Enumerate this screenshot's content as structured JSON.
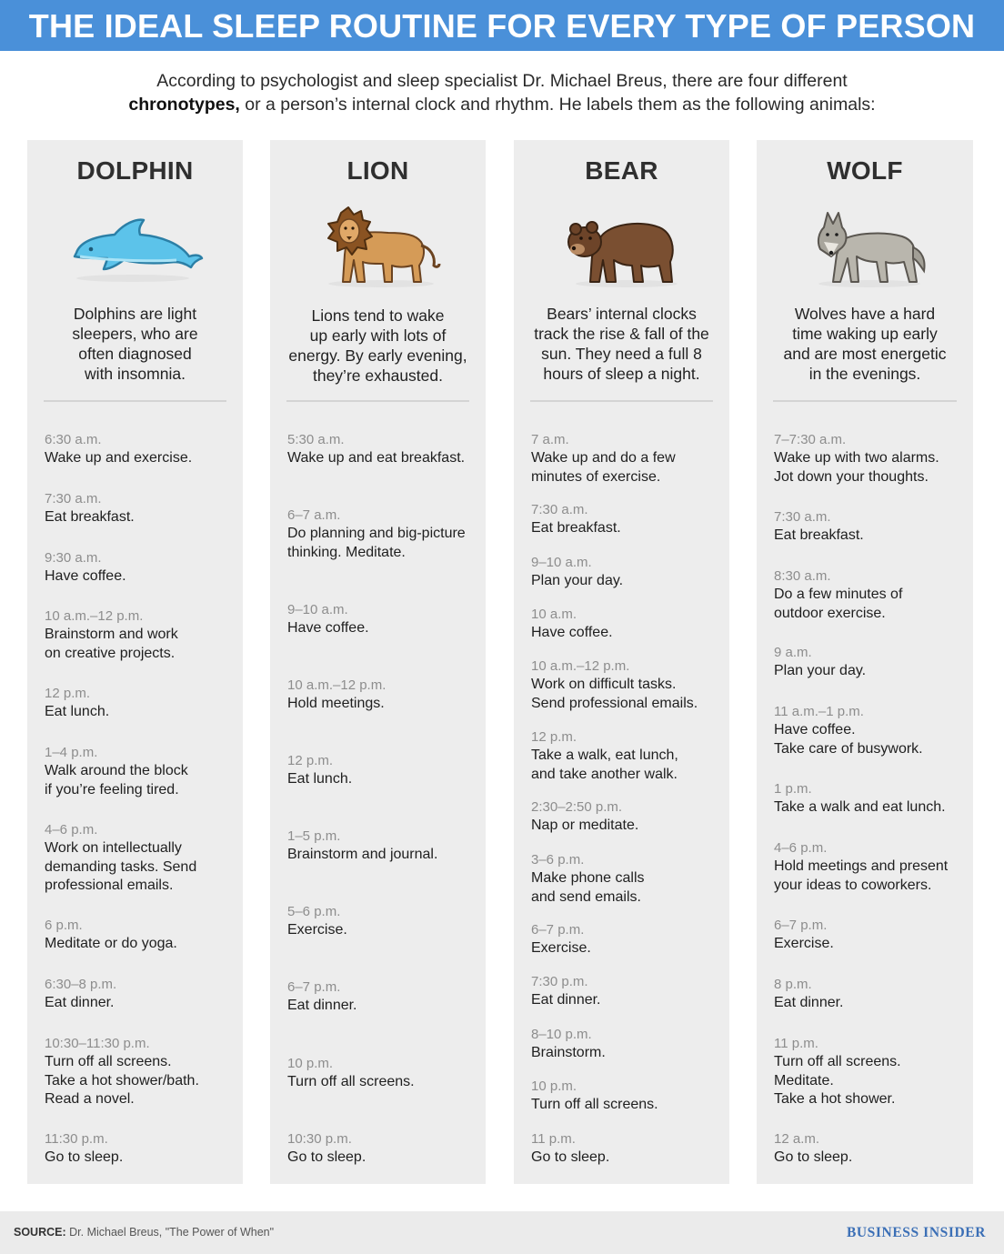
{
  "title": "THE IDEAL SLEEP ROUTINE FOR EVERY TYPE OF PERSON",
  "intro": {
    "line1": "According to psychologist and sleep specialist Dr. Michael Breus, there are four different",
    "line2_bold": "chronotypes,",
    "line2_rest": " or a person’s internal clock and rhythm. He labels them as the following animals:"
  },
  "columns": [
    {
      "name": "DOLPHIN",
      "icon": "dolphin-icon",
      "description": [
        "Dolphins are light",
        "sleepers, who are",
        "often diagnosed",
        "with insomnia."
      ],
      "entries": [
        {
          "time": "6:30 a.m.",
          "lines": [
            "Wake up and exercise."
          ]
        },
        {
          "time": "7:30 a.m.",
          "lines": [
            "Eat breakfast."
          ]
        },
        {
          "time": "9:30 a.m.",
          "lines": [
            "Have coffee."
          ]
        },
        {
          "time": "10 a.m.–12 p.m.",
          "lines": [
            "Brainstorm and work",
            "on creative projects."
          ]
        },
        {
          "time": "12 p.m.",
          "lines": [
            "Eat lunch."
          ]
        },
        {
          "time": "1–4 p.m.",
          "lines": [
            "Walk around the block",
            "if you’re feeling tired."
          ]
        },
        {
          "time": "4–6 p.m.",
          "lines": [
            "Work on intellectually",
            "demanding tasks. Send",
            "professional emails."
          ]
        },
        {
          "time": "6 p.m.",
          "lines": [
            "Meditate or do yoga."
          ]
        },
        {
          "time": "6:30–8 p.m.",
          "lines": [
            "Eat dinner."
          ]
        },
        {
          "time": "10:30–11:30 p.m.",
          "lines": [
            "Turn off all screens.",
            "Take a hot shower/bath.",
            "Read a novel."
          ]
        },
        {
          "time": "11:30 p.m.",
          "lines": [
            "Go to sleep."
          ]
        }
      ]
    },
    {
      "name": "LION",
      "icon": "lion-icon",
      "description": [
        "Lions tend to wake",
        "up early with lots of",
        "energy. By early evening,",
        "they’re exhausted."
      ],
      "entries": [
        {
          "time": "5:30 a.m.",
          "lines": [
            "Wake up and eat breakfast."
          ]
        },
        {
          "time": "6–7 a.m.",
          "lines": [
            "Do planning and big-picture",
            "thinking. Meditate."
          ]
        },
        {
          "time": "9–10 a.m.",
          "lines": [
            "Have coffee."
          ]
        },
        {
          "time": "10 a.m.–12 p.m.",
          "lines": [
            "Hold meetings."
          ]
        },
        {
          "time": "12 p.m.",
          "lines": [
            "Eat lunch."
          ]
        },
        {
          "time": "1–5 p.m.",
          "lines": [
            "Brainstorm and journal."
          ]
        },
        {
          "time": "5–6 p.m.",
          "lines": [
            "Exercise."
          ]
        },
        {
          "time": "6–7 p.m.",
          "lines": [
            "Eat dinner."
          ]
        },
        {
          "time": "10 p.m.",
          "lines": [
            "Turn off all screens."
          ]
        },
        {
          "time": "10:30 p.m.",
          "lines": [
            "Go to sleep."
          ]
        }
      ]
    },
    {
      "name": "BEAR",
      "icon": "bear-icon",
      "description": [
        "Bears’ internal clocks",
        "track the rise & fall of the",
        "sun. They need a full 8",
        "hours of sleep a night."
      ],
      "entries": [
        {
          "time": "7 a.m.",
          "lines": [
            "Wake up and do a few",
            "minutes of exercise."
          ]
        },
        {
          "time": "7:30 a.m.",
          "lines": [
            "Eat breakfast."
          ]
        },
        {
          "time": "9–10 a.m.",
          "lines": [
            "Plan your day."
          ]
        },
        {
          "time": "10 a.m.",
          "lines": [
            "Have coffee."
          ]
        },
        {
          "time": "10 a.m.–12 p.m.",
          "lines": [
            "Work on difficult tasks.",
            "Send professional emails."
          ]
        },
        {
          "time": "12 p.m.",
          "lines": [
            "Take a walk, eat lunch,",
            "and take another walk."
          ]
        },
        {
          "time": "2:30–2:50 p.m.",
          "lines": [
            "Nap or meditate."
          ]
        },
        {
          "time": "3–6 p.m.",
          "lines": [
            "Make phone calls",
            "and send emails."
          ]
        },
        {
          "time": "6–7 p.m.",
          "lines": [
            "Exercise."
          ]
        },
        {
          "time": "7:30 p.m.",
          "lines": [
            "Eat dinner."
          ]
        },
        {
          "time": "8–10 p.m.",
          "lines": [
            "Brainstorm."
          ]
        },
        {
          "time": "10 p.m.",
          "lines": [
            "Turn off all screens."
          ]
        },
        {
          "time": "11 p.m.",
          "lines": [
            "Go to sleep."
          ]
        }
      ]
    },
    {
      "name": "WOLF",
      "icon": "wolf-icon",
      "description": [
        "Wolves have a hard",
        "time waking up early",
        "and are most energetic",
        "in the evenings."
      ],
      "entries": [
        {
          "time": "7–7:30 a.m.",
          "lines": [
            "Wake up with two alarms.",
            "Jot down your thoughts."
          ]
        },
        {
          "time": "7:30 a.m.",
          "lines": [
            "Eat breakfast."
          ]
        },
        {
          "time": "8:30 a.m.",
          "lines": [
            "Do a few minutes of",
            "outdoor exercise."
          ]
        },
        {
          "time": "9 a.m.",
          "lines": [
            "Plan your day."
          ]
        },
        {
          "time": "11 a.m.–1 p.m.",
          "lines": [
            "Have coffee.",
            "Take care of busywork."
          ]
        },
        {
          "time": "1 p.m.",
          "lines": [
            "Take a walk and eat lunch."
          ]
        },
        {
          "time": "4–6 p.m.",
          "lines": [
            "Hold meetings and present",
            "your ideas to coworkers."
          ]
        },
        {
          "time": "6–7 p.m.",
          "lines": [
            "Exercise."
          ]
        },
        {
          "time": "8 p.m.",
          "lines": [
            "Eat dinner."
          ]
        },
        {
          "time": "11 p.m.",
          "lines": [
            "Turn off all screens.",
            "Meditate.",
            "Take a hot shower."
          ]
        },
        {
          "time": "12 a.m.",
          "lines": [
            "Go to sleep."
          ]
        }
      ]
    }
  ],
  "footer": {
    "source_label": "SOURCE:",
    "source_text": " Dr. Michael Breus, \"The Power of When\"",
    "brand": "BUSINESS INSIDER"
  },
  "colors": {
    "banner": "#4a90d9",
    "column_bg": "#ededed",
    "time_text": "#8d8d8d",
    "brand": "#3b6fb6"
  }
}
